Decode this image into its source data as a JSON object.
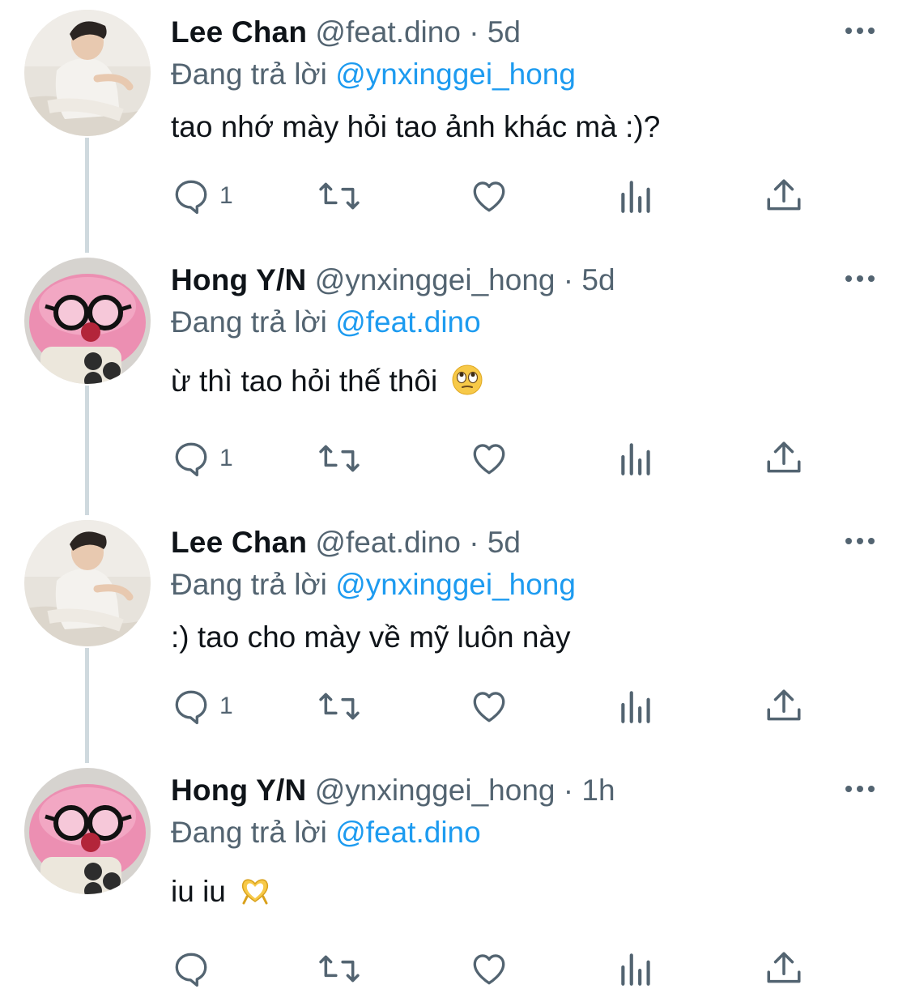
{
  "tweets": [
    {
      "author": {
        "name": "Lee Chan",
        "handle": "@feat.dino",
        "avatar": "boy-sitting-avatar"
      },
      "separator": "·",
      "time": "5d",
      "reply_prefix": "Đang trả lời",
      "reply_to": "@ynxinggei_hong",
      "text": "tao nhớ mày hỏi tao ảnh khác mà :)?",
      "emoji": "",
      "reply_count": "1"
    },
    {
      "author": {
        "name": "Hong Y/N",
        "handle": "@ynxinggei_hong",
        "avatar": "pink-plush-glasses-avatar"
      },
      "separator": "·",
      "time": "5d",
      "reply_prefix": "Đang trả lời",
      "reply_to": "@feat.dino",
      "text": "ừ thì tao hỏi thế thôi",
      "emoji": "eye-roll-emoji",
      "reply_count": "1"
    },
    {
      "author": {
        "name": "Lee Chan",
        "handle": "@feat.dino",
        "avatar": "boy-sitting-avatar"
      },
      "separator": "·",
      "time": "5d",
      "reply_prefix": "Đang trả lời",
      "reply_to": "@ynxinggei_hong",
      "text": ":) tao cho mày về mỹ luôn này",
      "emoji": "",
      "reply_count": "1"
    },
    {
      "author": {
        "name": "Hong Y/N",
        "handle": "@ynxinggei_hong",
        "avatar": "pink-plush-glasses-avatar"
      },
      "separator": "·",
      "time": "1h",
      "reply_prefix": "Đang trả lời",
      "reply_to": "@feat.dino",
      "text": "iu iu",
      "emoji": "heart-hands-emoji",
      "reply_count": ""
    }
  ],
  "icons": {
    "reply": "speech-bubble-icon",
    "retweet": "retweet-icon",
    "like": "heart-icon",
    "views": "bar-chart-icon",
    "share": "share-upload-icon",
    "more": "ellipsis-icon"
  },
  "colors": {
    "text": "#0f1419",
    "secondary": "#536471",
    "link": "#1d9bf0",
    "thread_line": "#cfd9de"
  }
}
